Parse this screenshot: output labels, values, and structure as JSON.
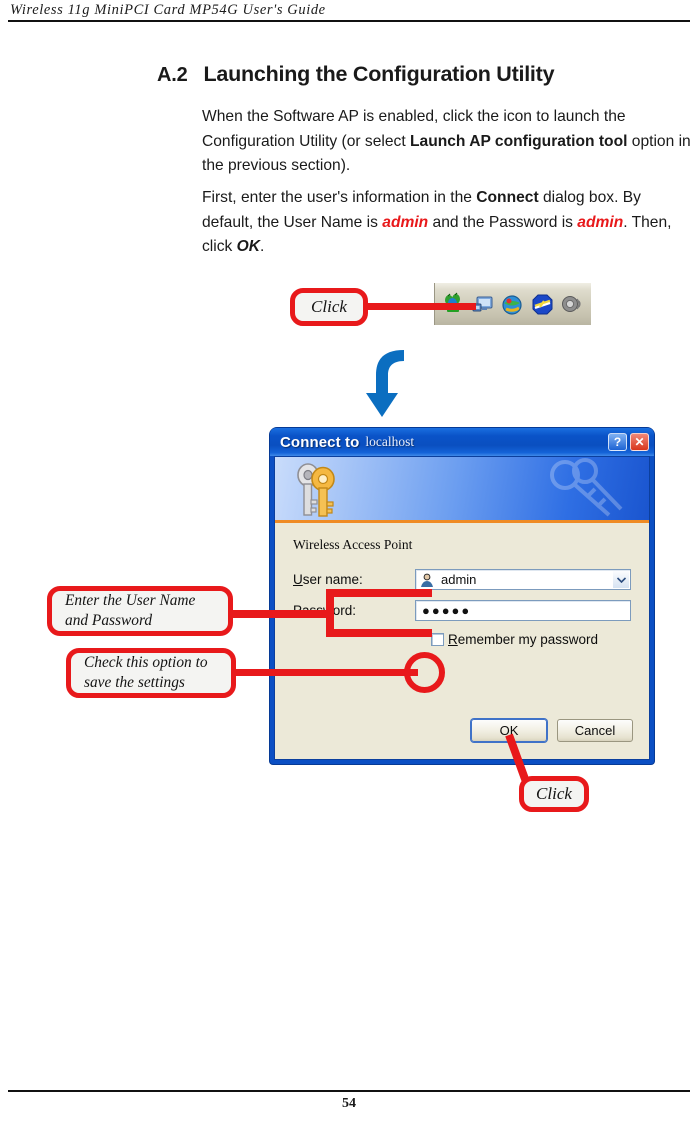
{
  "header": {
    "running_title": "Wireless 11g MiniPCI Card MP54G User's Guide"
  },
  "section": {
    "number": "A.2",
    "title": "Launching the Configuration Utility"
  },
  "paragraphs": {
    "p1_part1": "When the Software AP is enabled, click the icon to launch the Configuration Utility (or select ",
    "p1_bold": "Launch AP configuration tool",
    "p1_part2": " option in the previous section).",
    "p2_part1": "First, enter the user's information in the ",
    "p2_bold1": "Connect",
    "p2_part2": " dialog box.  By default, the User Name is ",
    "p2_red1": "admin",
    "p2_part3": " and the Password is ",
    "p2_red2": "admin",
    "p2_part4": ".  Then, click ",
    "p2_bold2": "OK",
    "p2_part5": "."
  },
  "callouts": {
    "click_top": "Click",
    "enter_credentials_line1": "Enter the User Name",
    "enter_credentials_line2": "and Password",
    "check_option_line1": "Check this option to",
    "check_option_line2": "save the settings",
    "click_bottom": "Click"
  },
  "tray": {
    "icons": [
      "wireless-network-icon",
      "network-connection-icon",
      "internet-globe-icon",
      "safely-remove-hardware-icon",
      "volume-speaker-icon"
    ]
  },
  "dialog": {
    "title_main": "Connect to",
    "title_sub": "localhost",
    "help_button": "?",
    "close_button": "✕",
    "banner_icon": "keys-icon",
    "access_point_label": "Wireless Access Point",
    "username": {
      "label_underlined": "U",
      "label_rest": "ser name:",
      "value": "admin",
      "icon": "user-account-icon",
      "dropdown_icon": "chevron-down-icon"
    },
    "password": {
      "label_underlined": "P",
      "label_rest": "assword:",
      "value": "●●●●●"
    },
    "remember": {
      "label_underlined": "R",
      "label_rest": "emember my password",
      "checked": false
    },
    "buttons": {
      "ok": "OK",
      "cancel": "Cancel"
    }
  },
  "footer": {
    "page_number": "54"
  },
  "colors": {
    "annotation_red": "#e8191b",
    "titlebar_blue": "#0a53c8",
    "arrow_blue": "#0b6ec0",
    "dialog_face": "#ece9d8",
    "banner_orange": "#ef8b24"
  }
}
